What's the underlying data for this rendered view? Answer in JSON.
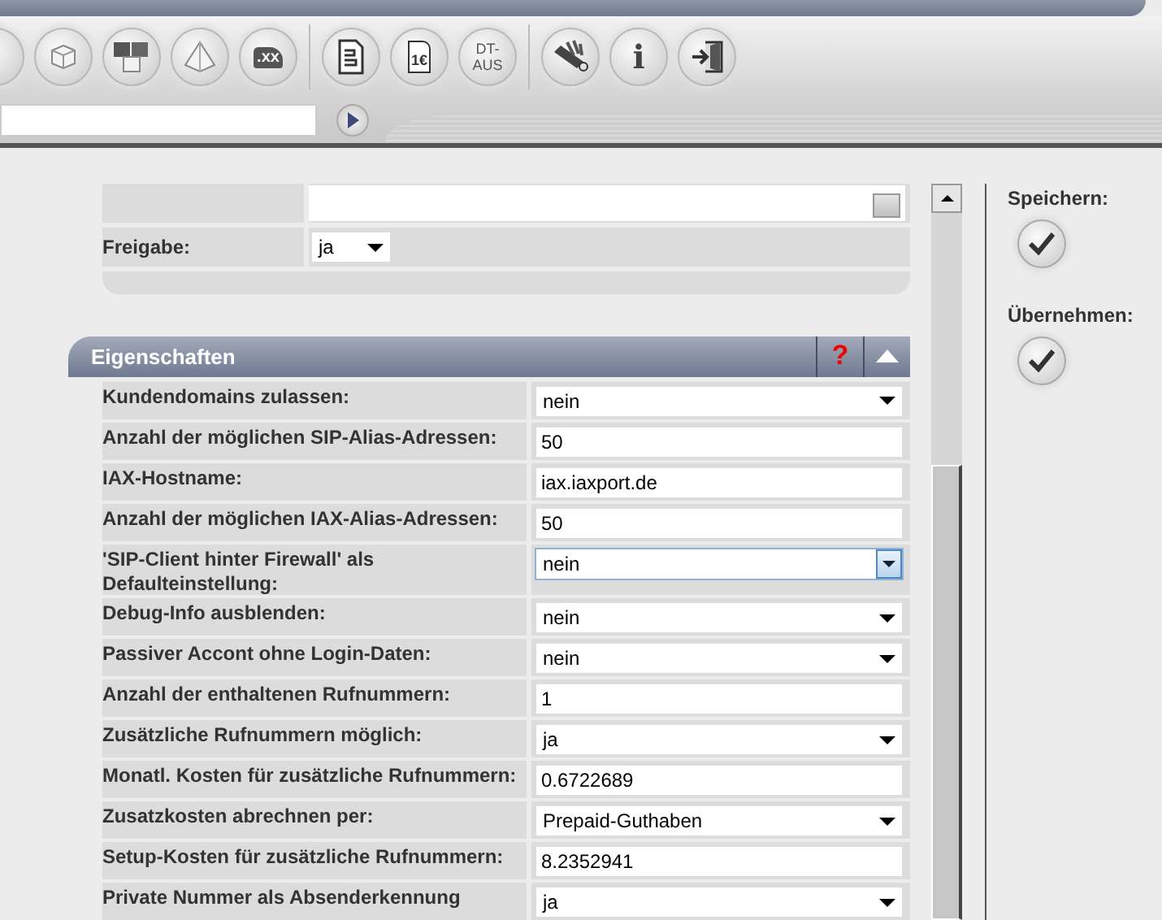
{
  "toolbar": {
    "groups": [
      [
        {
          "kind": "blank"
        },
        {
          "kind": "cube"
        },
        {
          "kind": "cubes"
        },
        {
          "kind": "pyramid"
        },
        {
          "kind": "domain",
          "text": ".xx"
        }
      ],
      [
        {
          "kind": "document"
        },
        {
          "kind": "invoice",
          "text": "1€"
        },
        {
          "kind": "label",
          "text": "DT-AUS"
        }
      ],
      [
        {
          "kind": "tools"
        },
        {
          "kind": "info",
          "text": "i"
        },
        {
          "kind": "exit"
        }
      ]
    ]
  },
  "upper_form": {
    "rows": [
      {
        "label": "",
        "kind": "list",
        "value": ""
      },
      {
        "label": "Freigabe:",
        "kind": "small-select",
        "value": "ja"
      }
    ]
  },
  "section": {
    "title": "Eigenschaften",
    "help": "?",
    "rows": [
      {
        "label": "Kundendomains zulassen:",
        "kind": "select",
        "value": "nein",
        "focused": false
      },
      {
        "label": "Anzahl der möglichen SIP-Alias-Adressen:",
        "kind": "text",
        "value": "50",
        "focused": false
      },
      {
        "label": "IAX-Hostname:",
        "kind": "text",
        "value": "iax.iaxport.de",
        "focused": false
      },
      {
        "label": "Anzahl der möglichen IAX-Alias-Adressen:",
        "kind": "text",
        "value": "50",
        "focused": false
      },
      {
        "label": "'SIP-Client hinter Firewall' als Defaulteinstellung:",
        "kind": "select",
        "value": "nein",
        "focused": true
      },
      {
        "label": "Debug-Info ausblenden:",
        "kind": "select",
        "value": "nein",
        "focused": false
      },
      {
        "label": "Passiver Accont ohne Login-Daten:",
        "kind": "select",
        "value": "nein",
        "focused": false
      },
      {
        "label": "Anzahl der enthaltenen Rufnummern:",
        "kind": "text",
        "value": "1",
        "focused": false
      },
      {
        "label": "Zusätzliche Rufnummern möglich:",
        "kind": "select",
        "value": "ja",
        "focused": false
      },
      {
        "label": "Monatl. Kosten für zusätzliche Rufnummern:",
        "kind": "text",
        "value": "0.6722689",
        "focused": false
      },
      {
        "label": "Zusatzkosten abrechnen per:",
        "kind": "select",
        "value": "Prepaid-Guthaben",
        "focused": false
      },
      {
        "label": "Setup-Kosten für zusätzliche Rufnummern:",
        "kind": "text",
        "value": "8.2352941",
        "focused": false
      },
      {
        "label": "Private Nummer als Absenderkennung",
        "kind": "select",
        "value": "ja",
        "focused": false
      }
    ]
  },
  "actions": [
    {
      "label": "Speichern:"
    },
    {
      "label": "Übernehmen:"
    }
  ]
}
